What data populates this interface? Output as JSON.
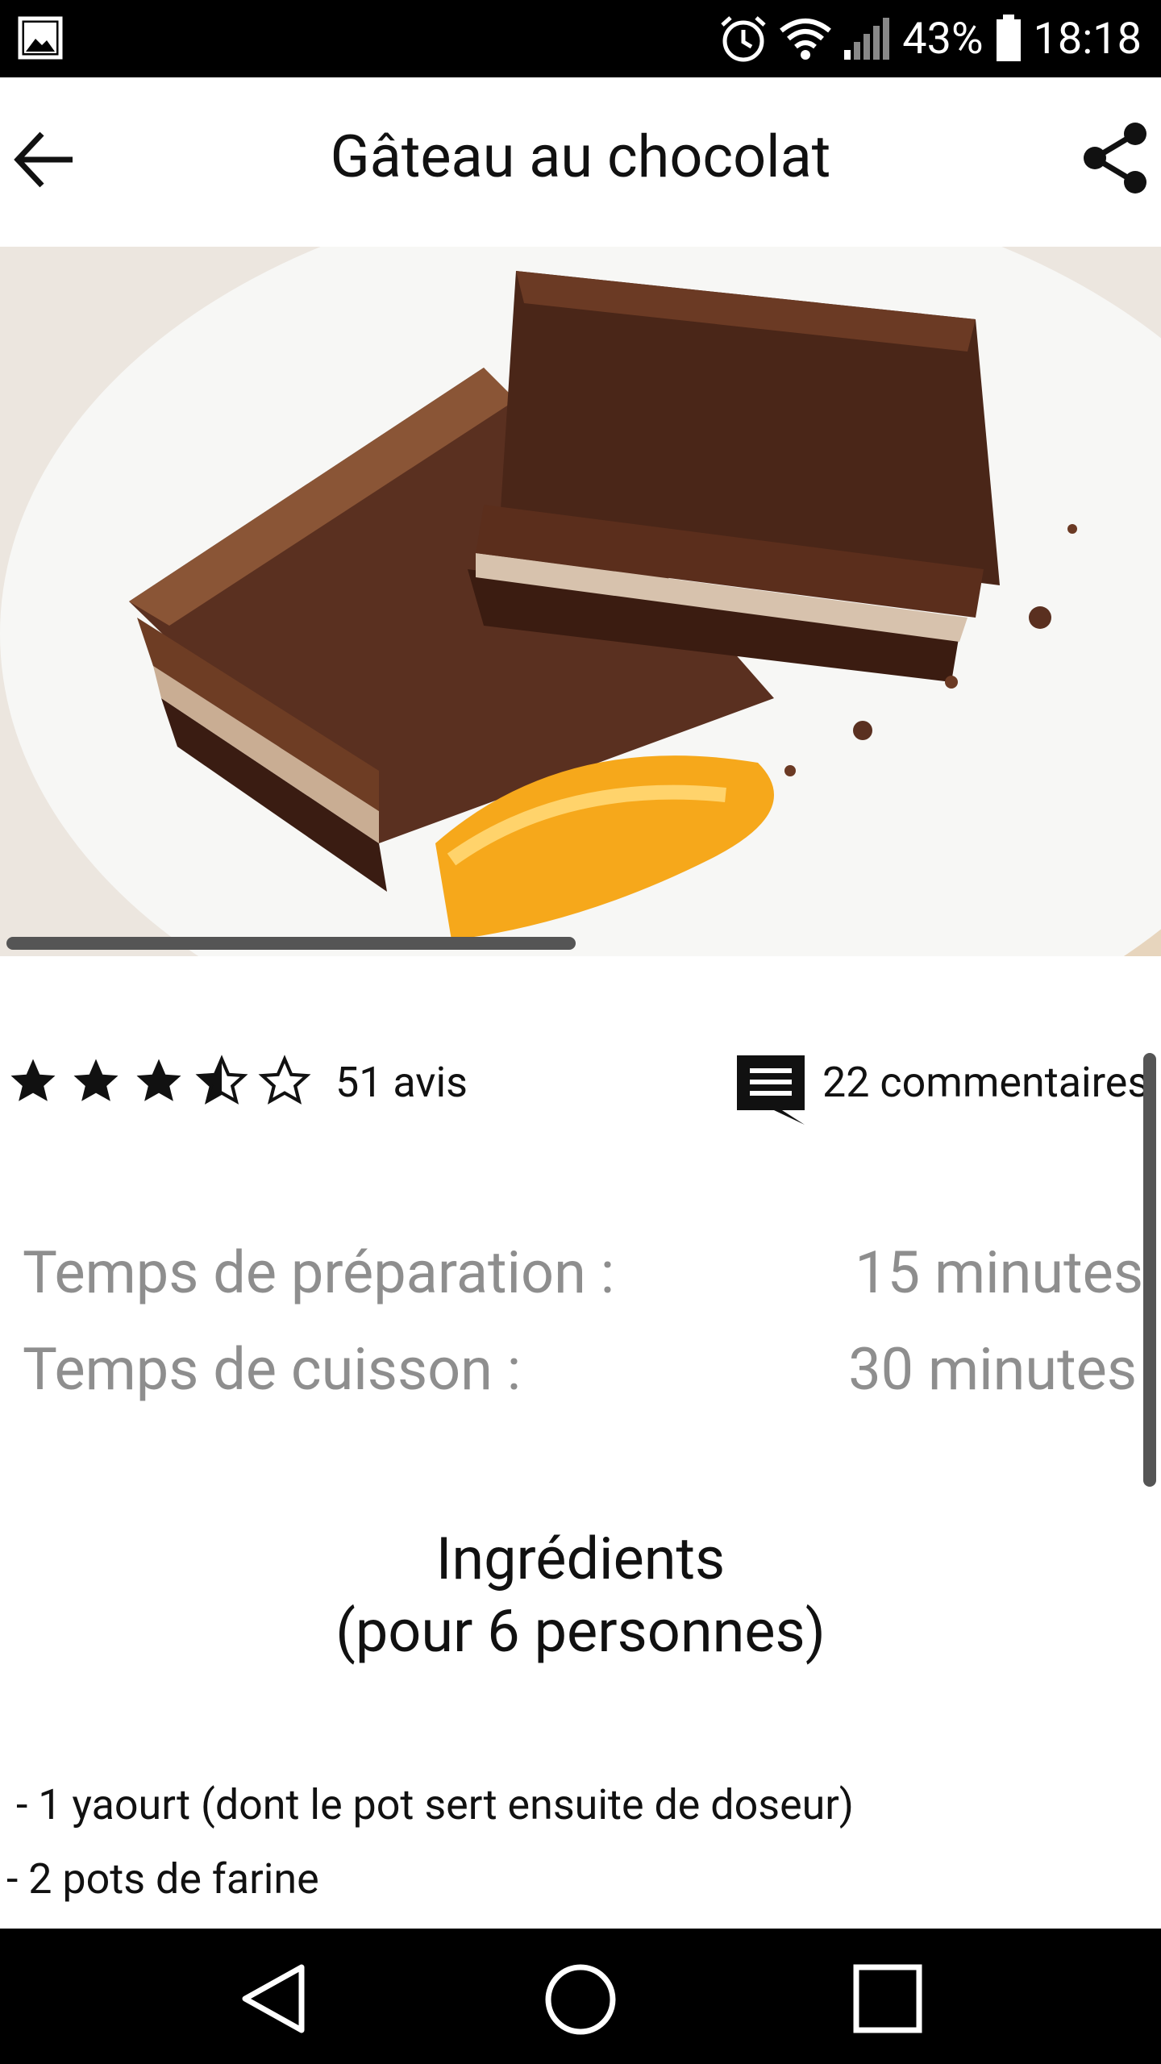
{
  "status_bar": {
    "battery": "43%",
    "time": "18:18",
    "icons": [
      "gallery-icon",
      "alarm-icon",
      "wifi-icon",
      "signal-icon",
      "battery-icon"
    ]
  },
  "app_bar": {
    "title": "Gâteau au chocolat",
    "icons": [
      "arrow-back-icon",
      "share-icon"
    ]
  },
  "recipe": {
    "rating": 3.5,
    "rating_max": 5,
    "reviews_label": "51 avis",
    "comments_label": "22 commentaires",
    "times": [
      {
        "label": "Temps de préparation :",
        "value": "15 minutes"
      },
      {
        "label": "Temps de cuisson :",
        "value": "30 minutes"
      }
    ],
    "ingredients_title_line1": "Ingrédients",
    "ingredients_title_line2": "(pour 6 personnes)",
    "ingredients": [
      " - 1 yaourt (dont le pot sert ensuite de doseur)",
      "- 2 pots de farine"
    ]
  },
  "nav_bar": {
    "icons": [
      "back-triangle-icon",
      "home-circle-icon",
      "recents-square-icon"
    ]
  },
  "colors": {
    "status_bar": "#000000",
    "muted_text": "#8e8e8e",
    "scrollbar": "#555555"
  }
}
